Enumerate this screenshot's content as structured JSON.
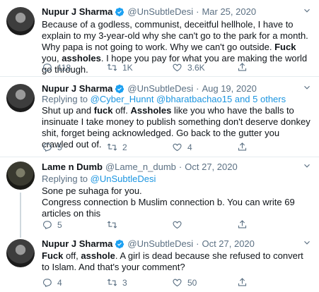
{
  "tweets": [
    {
      "name": "Nupur J Sharma",
      "handle": "@UnSubtleDesi",
      "separator": "·",
      "date": "Mar 25, 2020",
      "replying_prefix": "",
      "replying_to": "",
      "text_parts": [
        {
          "t": "Because of a godless, communist, deceitful hellhole, I have to explain to my 3-year-old why she can't go to the park for a month. Why papa is not going to work. Why we can't go outside. ",
          "b": false
        },
        {
          "t": "Fuck",
          "b": true
        },
        {
          "t": " you, ",
          "b": false
        },
        {
          "t": "assholes",
          "b": true
        },
        {
          "t": ". I hope you pay for what you are making the world go through.",
          "b": false
        }
      ],
      "reply_count": "118",
      "retweet_count": "1K",
      "like_count": "3.6K",
      "verified": true
    },
    {
      "name": "Nupur J Sharma",
      "handle": "@UnSubtleDesi",
      "separator": "·",
      "date": "Aug 19, 2020",
      "replying_prefix": "Replying to ",
      "replying_to": "@Cyber_Hunnt @bharatbachao15 and 5 others",
      "text_parts": [
        {
          "t": "Shut up and ",
          "b": false
        },
        {
          "t": "fuck",
          "b": true
        },
        {
          "t": " off. ",
          "b": false
        },
        {
          "t": "Assholes",
          "b": true
        },
        {
          "t": " like you who have the balls to insinuate I take money to publish something don't deserve donkey shit, forget being acknowledged. Go back to the gutter you crawled out of.",
          "b": false
        }
      ],
      "reply_count": "5",
      "retweet_count": "2",
      "like_count": "4",
      "verified": true
    },
    {
      "name": "Lame n Dumb",
      "handle": "@Lame_n_dumb",
      "separator": "·",
      "date": "Oct 27, 2020",
      "replying_prefix": "Replying to ",
      "replying_to": "@UnSubtleDesi",
      "text_parts": [
        {
          "t": "Sone pe suhaga for you.\nCongress connection b Muslim connection b. You can write 69 articles on this",
          "b": false
        }
      ],
      "reply_count": "5",
      "retweet_count": "",
      "like_count": "",
      "verified": false
    },
    {
      "name": "Nupur J Sharma",
      "handle": "@UnSubtleDesi",
      "separator": "·",
      "date": "Oct 27, 2020",
      "replying_prefix": "",
      "replying_to": "",
      "text_parts": [
        {
          "t": "Fuck",
          "b": true
        },
        {
          "t": " off, ",
          "b": false
        },
        {
          "t": "asshole",
          "b": true
        },
        {
          "t": ". A girl is dead because she refused to convert to Islam. And that's your comment?",
          "b": false
        }
      ],
      "reply_count": "4",
      "retweet_count": "3",
      "like_count": "50",
      "verified": true
    }
  ],
  "colors": {
    "name": "#0f1419",
    "secondary": "#5b7083",
    "link": "#1b95e0",
    "verified": "#1da1f2",
    "border": "#e6ecf0"
  },
  "icons": [
    "verified-badge-icon",
    "chevron-down-icon",
    "reply-icon",
    "retweet-icon",
    "like-icon",
    "share-icon"
  ]
}
